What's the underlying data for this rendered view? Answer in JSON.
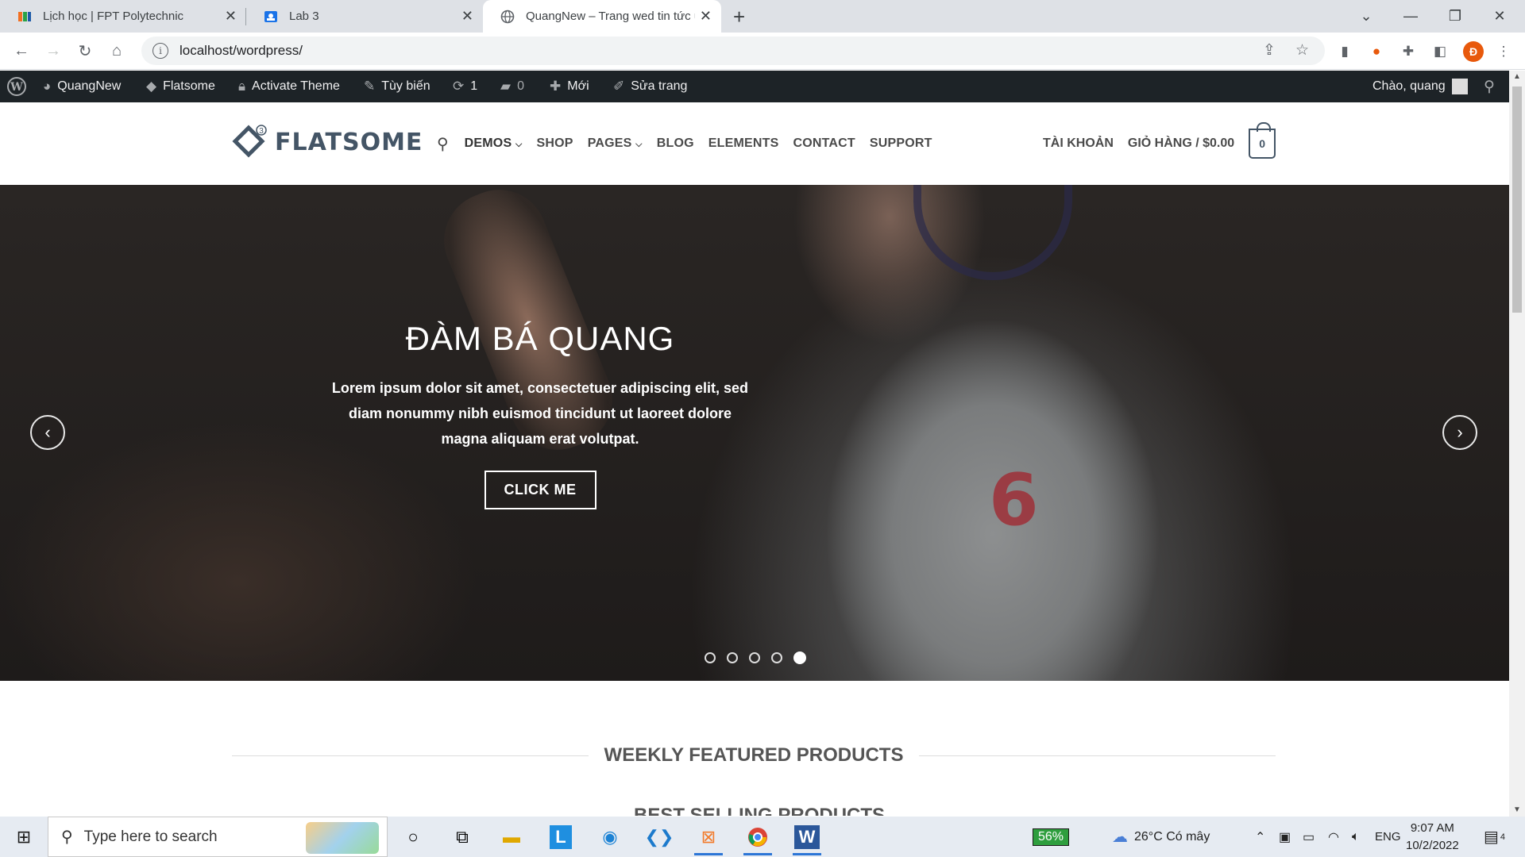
{
  "browser": {
    "tabs": [
      {
        "title": "Lịch học | FPT Polytechnic",
        "active": false
      },
      {
        "title": "Lab 3",
        "active": false
      },
      {
        "title": "QuangNew – Trang wed tin tức u",
        "active": true
      }
    ],
    "url": "localhost/wordpress/",
    "profile_initial": "Đ"
  },
  "adminbar": {
    "site_name": "QuangNew",
    "theme": "Flatsome",
    "activate": "Activate Theme",
    "customize": "Tùy biến",
    "updates_count": "1",
    "comments_count": "0",
    "new_label": "Mới",
    "edit_page": "Sửa trang",
    "greeting": "Chào, quang"
  },
  "header": {
    "logo_text": "FLATSOME",
    "logo_badge": "3",
    "nav": [
      "DEMOS",
      "SHOP",
      "PAGES",
      "BLOG",
      "ELEMENTS",
      "CONTACT",
      "SUPPORT"
    ],
    "account": "TÀI KHOẢN",
    "cart": "GIỎ HÀNG / $0.00",
    "cart_count": "0"
  },
  "hero": {
    "title": "ĐÀM BÁ QUANG",
    "text": "Lorem ipsum dolor sit amet, consectetuer adipiscing elit, sed diam nonummy nibh euismod tincidunt ut laoreet dolore magna aliquam erat volutpat.",
    "button": "CLICK ME",
    "slide_count": 5,
    "active_slide": 5,
    "shirt_number": "6"
  },
  "section": {
    "title": "WEEKLY FEATURED PRODUCTS",
    "subtitle": "BEST SELLING PRODUCTS"
  },
  "taskbar": {
    "search_placeholder": "Type here to search",
    "battery": "56%",
    "weather": "26°C  Có mây",
    "language": "ENG",
    "time": "9:07 AM",
    "date": "10/2/2022",
    "notifications": "4"
  }
}
